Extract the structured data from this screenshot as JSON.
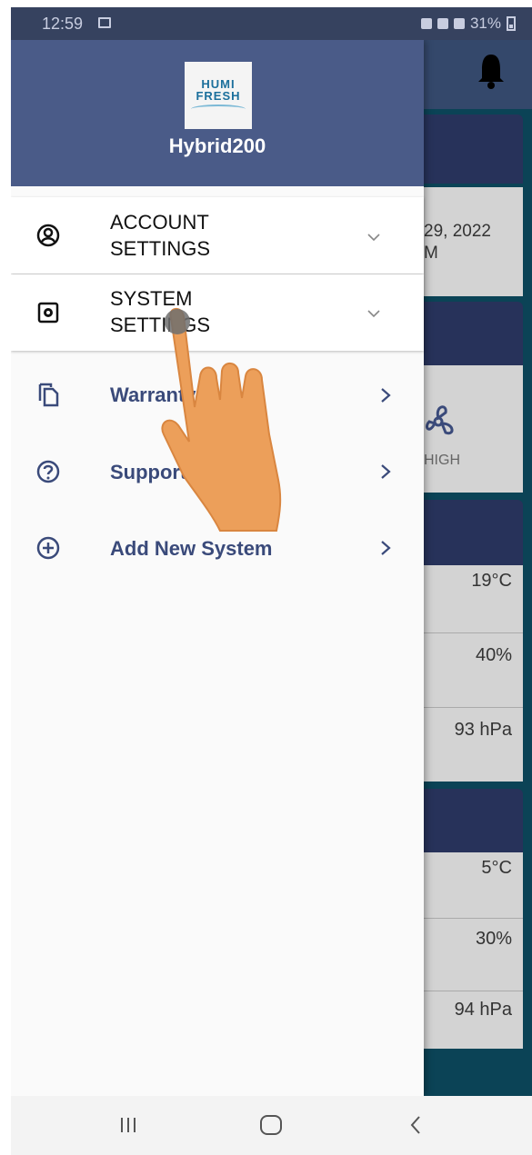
{
  "status_bar": {
    "time": "12:59",
    "battery": "31%"
  },
  "drawer": {
    "logo": {
      "line1": "HUMI",
      "line2": "FRESH"
    },
    "system_name": "Hybrid200",
    "items": [
      {
        "label_line1": "ACCOUNT",
        "label_line2": "SETTINGS",
        "icon": "account-circle-icon",
        "indicator": "chevron-down-icon"
      },
      {
        "label_line1": "SYSTEM",
        "label_line2": "SETTINGS",
        "icon": "settings-gear-icon",
        "indicator": "chevron-down-icon"
      },
      {
        "label": "Warranty",
        "icon": "copy-document-icon",
        "indicator": "chevron-right-icon"
      },
      {
        "label": "Support",
        "icon": "help-circle-icon",
        "indicator": "chevron-right-icon"
      },
      {
        "label": "Add New System",
        "icon": "add-circle-icon",
        "indicator": "chevron-right-icon"
      }
    ]
  },
  "background": {
    "date_fragment_1": "29, 2022",
    "date_fragment_2": "M",
    "fan_mode": "HIGH",
    "values": [
      "19°C",
      "40%",
      "93 hPa",
      "5°C",
      "30%",
      "94 hPa"
    ]
  },
  "colors": {
    "drawer_header": "#4a5b88",
    "accent_text": "#3a4a7a",
    "background_dark": "#0b4356",
    "card_header": "#27325a"
  }
}
